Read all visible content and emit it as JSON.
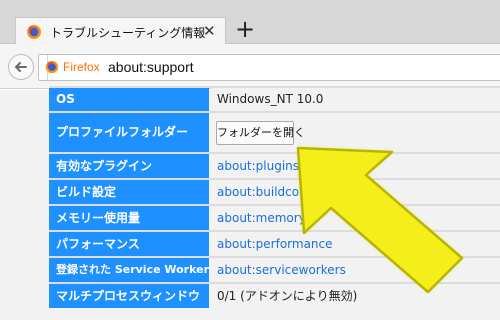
{
  "browser": {
    "tab_title": "トラブルシューティング情報",
    "tab_close": "✕",
    "new_tab": "+",
    "identity_label": "Firefox",
    "url": "about:support"
  },
  "table": {
    "rows": [
      {
        "key": "OS",
        "value": "Windows_NT 10.0",
        "type": "text"
      },
      {
        "key": "プロファイルフォルダー",
        "value": "フォルダーを開く",
        "type": "button"
      },
      {
        "key": "有効なプラグイン",
        "value": "about:plugins",
        "type": "link"
      },
      {
        "key": "ビルド設定",
        "value": "about:buildconfig",
        "type": "link"
      },
      {
        "key": "メモリー使用量",
        "value": "about:memory",
        "type": "link"
      },
      {
        "key": "パフォーマンス",
        "value": "about:performance",
        "type": "link"
      },
      {
        "key": "登録された Service Workers",
        "value": "about:serviceworkers",
        "type": "link"
      },
      {
        "key": "マルチプロセスウィンドウ",
        "value": "0/1 (アドオンにより無効)",
        "type": "text"
      }
    ]
  },
  "colors": {
    "header_cell": "#1e90ff",
    "link": "#1a6fd8",
    "arrow_fill": "#f4ef1a",
    "arrow_stroke": "#b8b400"
  },
  "icons": {
    "tab": "firefox-icon",
    "back": "back-arrow-icon",
    "identity": "firefox-icon",
    "annotation": "yellow-pointer-arrow"
  }
}
